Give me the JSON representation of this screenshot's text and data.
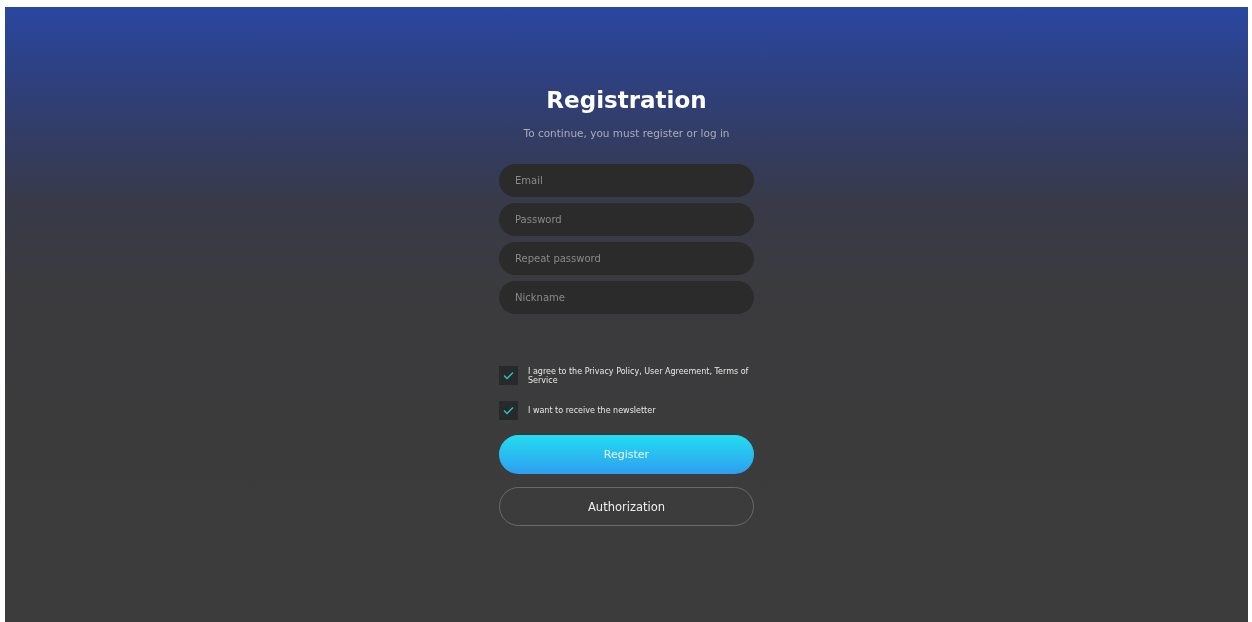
{
  "title": "Registration",
  "subtitle": "To continue, you must register or log in",
  "fields": [
    {
      "placeholder": "Email"
    },
    {
      "placeholder": "Password"
    },
    {
      "placeholder": "Repeat password"
    },
    {
      "placeholder": "Nickname"
    }
  ],
  "checkboxes": [
    {
      "label": "I agree to the Privacy Policy, User Agreement, Terms of Service",
      "checked": true
    },
    {
      "label": "I want to receive the newsletter",
      "checked": true
    }
  ],
  "buttons": [
    {
      "label": "Register",
      "kind": "primary"
    },
    {
      "label": "Authorization",
      "kind": "outline"
    }
  ]
}
